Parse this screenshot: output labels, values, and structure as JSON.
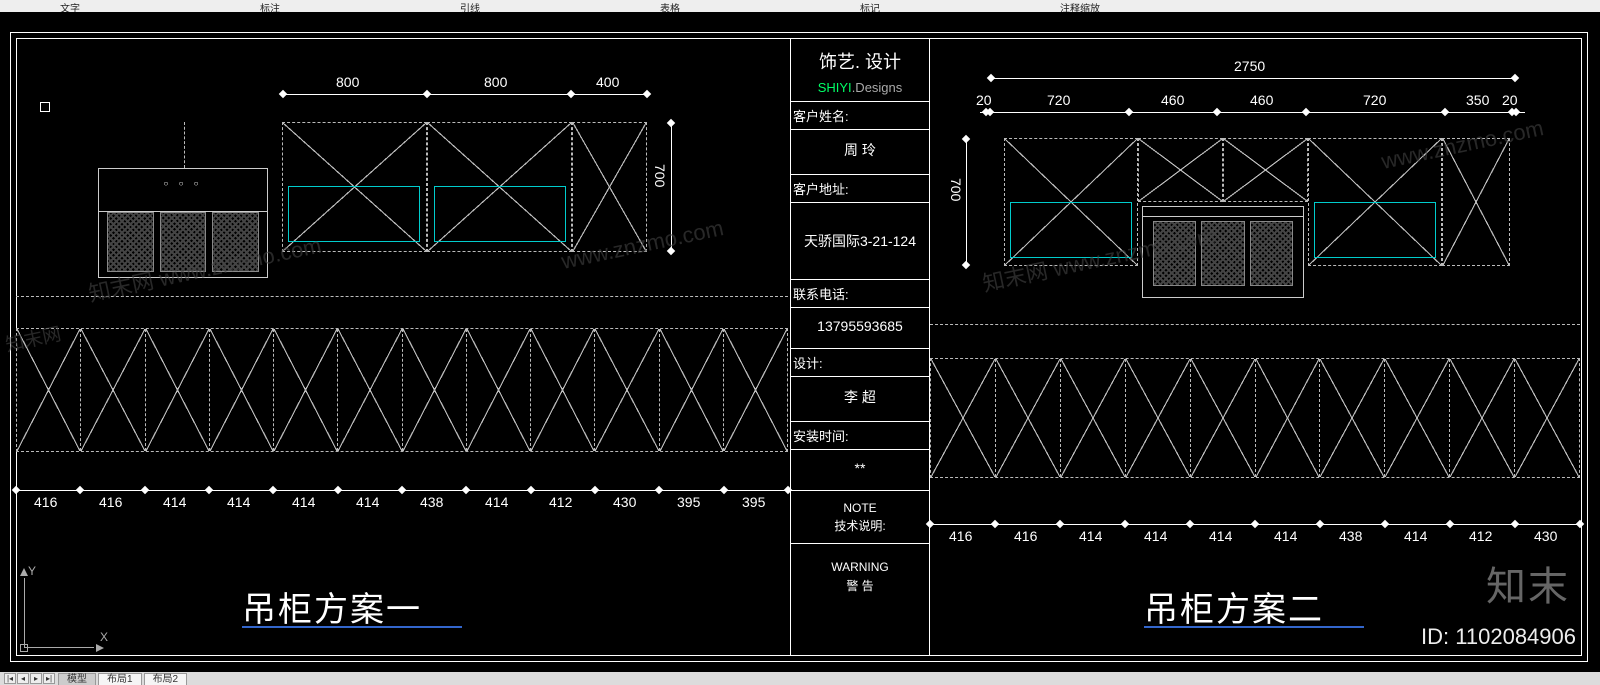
{
  "menu": {
    "items": [
      "文字",
      "标注",
      "引线",
      "表格",
      "标记",
      "注释缩放"
    ]
  },
  "titleblock": {
    "brand": "饰艺. 设计",
    "brand_sub_a": "SHIYI",
    "brand_sub_b": ".Designs",
    "rows": {
      "client_label": "客户姓名:",
      "client_value": "周 玲",
      "addr_label": "客户地址:",
      "addr_value": "天骄国际3-21-124",
      "phone_label": "联系电话:",
      "phone_value": "13795593685",
      "design_label": "设计:",
      "design_value": "李 超",
      "install_label": "安装时间:",
      "install_value": "**",
      "note_a": "NOTE",
      "note_b": "技术说明:",
      "warn_a": "WARNING",
      "warn_b": "警  告"
    }
  },
  "left": {
    "title": "吊柜方案一",
    "top_dims": [
      "800",
      "800",
      "400"
    ],
    "height_dim": "700",
    "bottom_dims": [
      "416",
      "416",
      "414",
      "414",
      "414",
      "414",
      "438",
      "414",
      "412",
      "430",
      "395",
      "395"
    ]
  },
  "right": {
    "title": "吊柜方案二",
    "overall_dim": "2750",
    "top_dims": [
      "20",
      "720",
      "460",
      "460",
      "720",
      "350",
      "20"
    ],
    "height_dim": "700",
    "bottom_dims": [
      "416",
      "416",
      "414",
      "414",
      "414",
      "414",
      "438",
      "414",
      "412",
      "430"
    ]
  },
  "axes": {
    "y": "Y",
    "x": "X"
  },
  "watermark": {
    "url": "www.znzmo.com",
    "brand_cn": "知末网",
    "wm_big": "知末",
    "id_label": "ID: 1102084906"
  },
  "tabs": {
    "model": "模型",
    "layout1": "布局1",
    "layout2": "布局2"
  }
}
